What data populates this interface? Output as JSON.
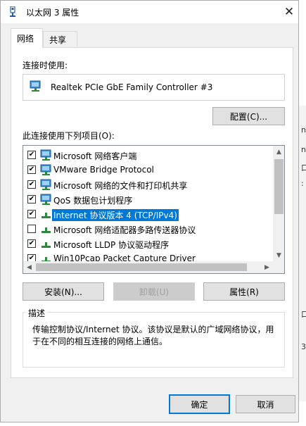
{
  "window": {
    "title": "以太网 3 属性",
    "close_label": "✕"
  },
  "tabs": [
    {
      "label": "网络",
      "active": true
    },
    {
      "label": "共享",
      "active": false
    }
  ],
  "connect_using": {
    "label": "连接时使用:",
    "adapter_name": "Realtek PCIe GbE Family Controller #3",
    "configure_button": "配置(C)..."
  },
  "items_section": {
    "label": "此连接使用下列项目(O):",
    "items": [
      {
        "label": "Microsoft 网络客户端",
        "checked": true,
        "selected": false,
        "icon": "network-client-icon"
      },
      {
        "label": "VMware Bridge Protocol",
        "checked": true,
        "selected": false,
        "icon": "network-client-icon"
      },
      {
        "label": "Microsoft 网络的文件和打印机共享",
        "checked": true,
        "selected": false,
        "icon": "network-client-icon"
      },
      {
        "label": "QoS 数据包计划程序",
        "checked": true,
        "selected": false,
        "icon": "network-client-icon"
      },
      {
        "label": "Internet 协议版本 4 (TCP/IPv4)",
        "checked": true,
        "selected": true,
        "icon": "protocol-icon"
      },
      {
        "label": "Microsoft 网络适配器多路传送器协议",
        "checked": false,
        "selected": false,
        "icon": "protocol-icon"
      },
      {
        "label": "Microsoft LLDP 协议驱动程序",
        "checked": true,
        "selected": false,
        "icon": "protocol-icon"
      },
      {
        "label": "Win10Pcap Packet Capture Driver",
        "checked": true,
        "selected": false,
        "icon": "protocol-icon"
      }
    ]
  },
  "buttons": {
    "install": "安装(N)...",
    "uninstall": "卸载(U)",
    "properties": "属性(R)"
  },
  "description": {
    "title": "描述",
    "text": "传输控制协议/Internet 协议。该协议是默认的广域网络协议，用于在不同的相互连接的网络上通信。"
  },
  "footer": {
    "ok": "确定",
    "cancel": "取消"
  },
  "background_window": {
    "fragments": [
      "nt",
      "nt",
      "口",
      ":",
      "口",
      "3"
    ]
  },
  "colors": {
    "selection": "#0078d7",
    "dialog_bg": "#f0f0f0",
    "focus_border": "#0078d7"
  }
}
